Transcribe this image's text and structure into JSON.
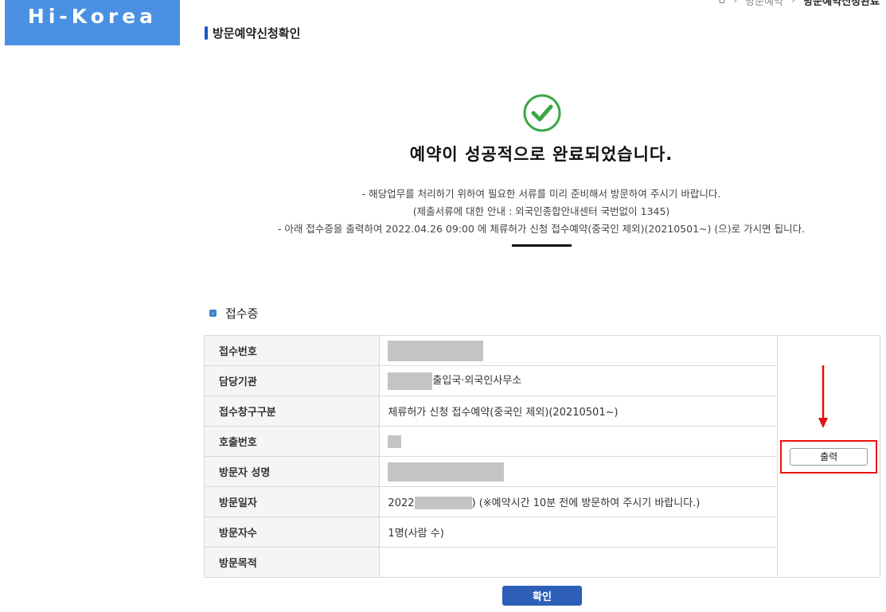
{
  "header": {
    "logo": "Hi-Korea",
    "breadcrumb": {
      "home": "⌂",
      "sep": "›",
      "level1": "방문예약",
      "level2": "방문예약신청완료"
    }
  },
  "page": {
    "title": "방문예약신청확인"
  },
  "message": {
    "title": "예약이 성공적으로 완료되었습니다.",
    "line1": "- 해당업무를 처리하기 위하여 필요한 서류를 미리 준비해서 방문하여 주시기 바랍니다.",
    "line2": "(제출서류에 대한 안내 : 외국인종합안내센터 국번없이 1345)",
    "line3": "- 아래 접수증을 출력하여 2022.04.26 09:00 에 체류허가 신청 접수예약(중국인 제외)(20210501~) (으)로 가시면 됩니다."
  },
  "receipt": {
    "section_title": "접수증",
    "rows": [
      {
        "label": "접수번호",
        "value": ""
      },
      {
        "label": "담당기관",
        "value": "출입국·외국인사무소"
      },
      {
        "label": "접수창구구분",
        "value": "체류허가 신청 접수예약(중국인 제외)(20210501~)"
      },
      {
        "label": "호출번호",
        "value": ""
      },
      {
        "label": "방문자 성명",
        "value": ""
      },
      {
        "label": "방문일자",
        "value_prefix": "2022",
        "value_suffix": ") (※예약시간 10분 전에 방문하여 주시기 바랍니다.)"
      },
      {
        "label": "방문자수",
        "value": "1명(사람 수)"
      },
      {
        "label": "방문목적",
        "value": ""
      }
    ],
    "print_label": "출력"
  },
  "actions": {
    "confirm_label": "확인"
  },
  "colors": {
    "logo_bg": "#4a90e2",
    "check": "#3aa845",
    "highlight": "#e11111",
    "confirm_bg": "#2d5fb8"
  }
}
